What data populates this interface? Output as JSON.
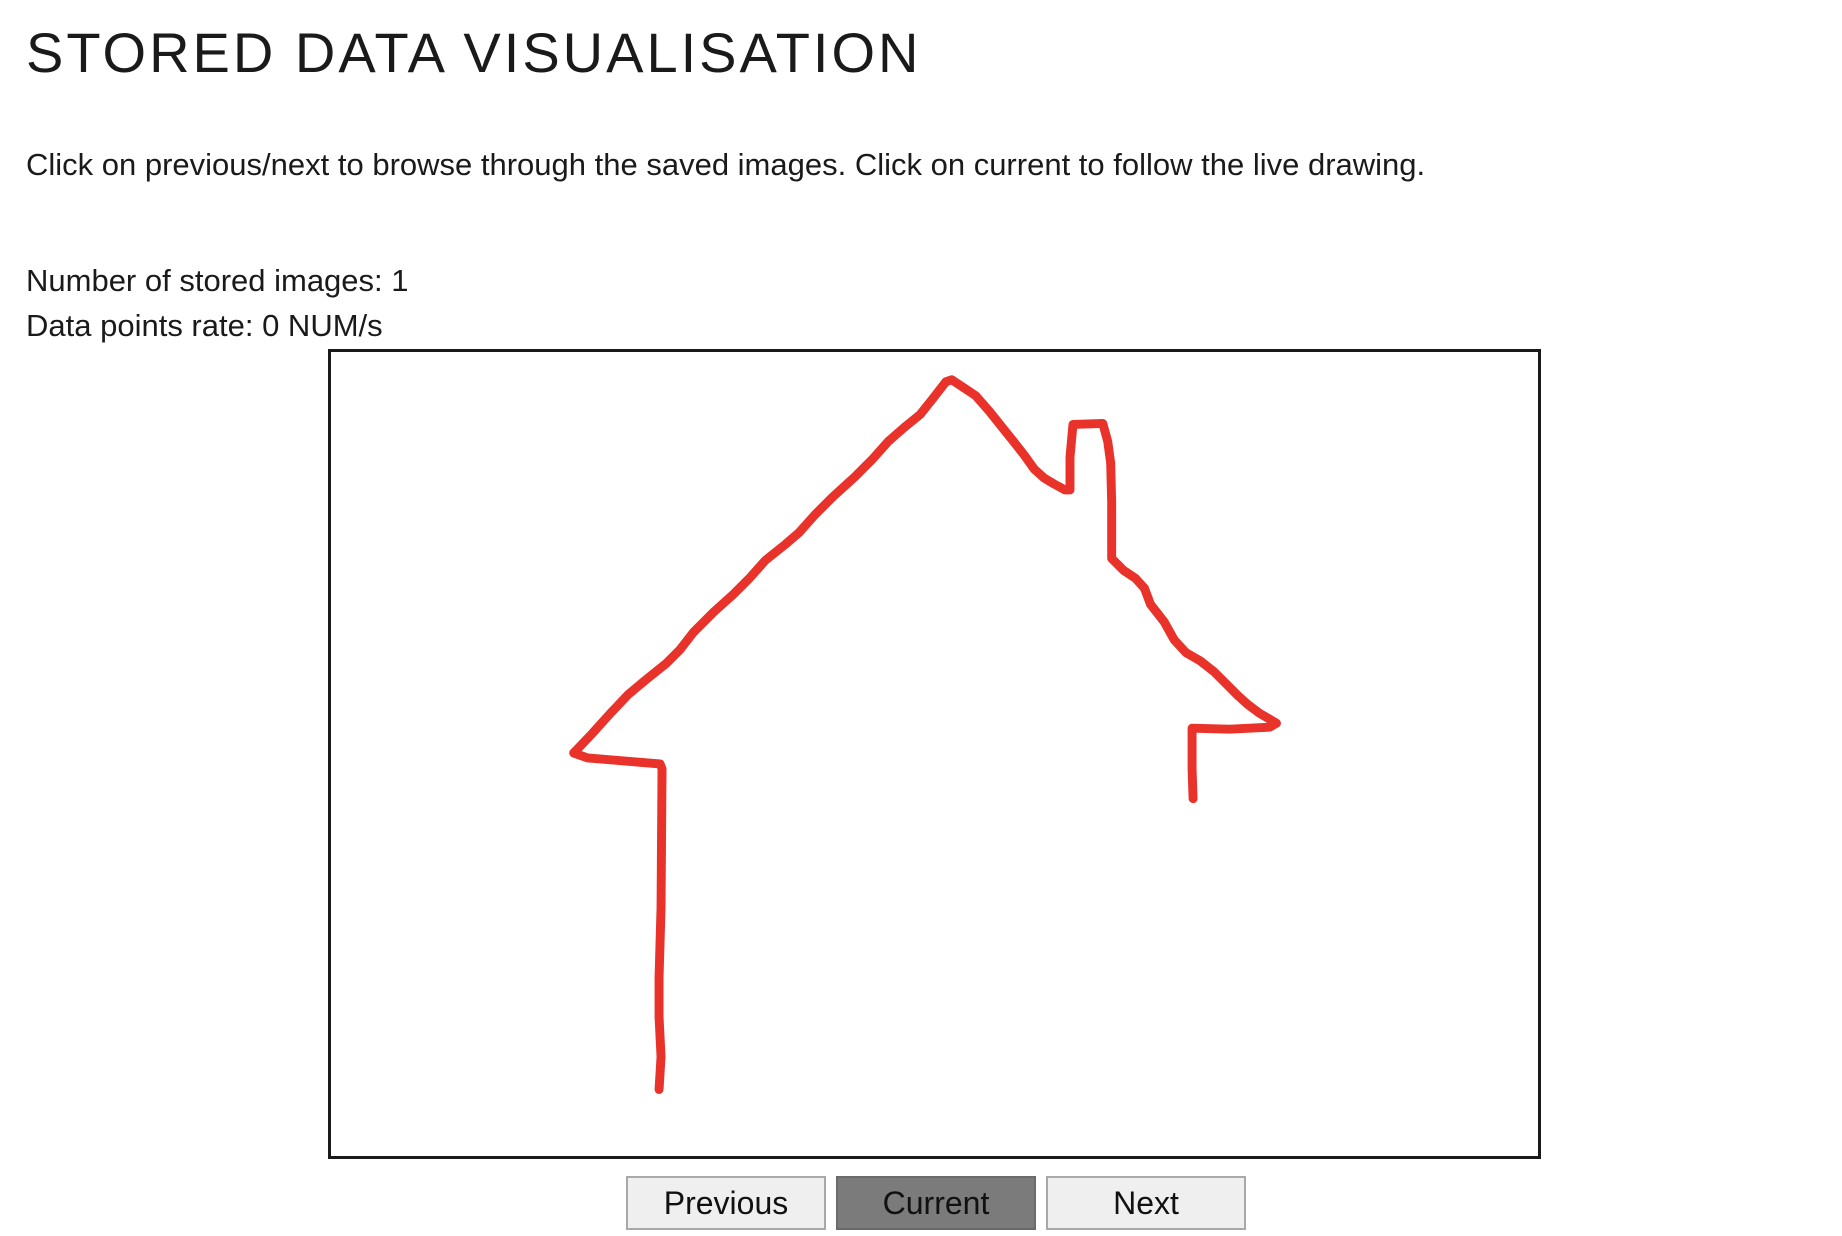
{
  "page": {
    "title": "STORED DATA VISUALISATION",
    "instructions": "Click on previous/next to browse through the saved images. Click on current to follow the live drawing."
  },
  "stats": {
    "stored_images_text": "Number of stored images: 1",
    "rate_text": "Data points rate: 0 NUM/s"
  },
  "drawing": {
    "stroke_color": "#e8322a",
    "description_icon": "house-sketch"
  },
  "buttons": {
    "previous_label": "Previous",
    "current_label": "Current",
    "next_label": "Next",
    "active": "current",
    "active_color": "#7b7b7b",
    "inactive_color": "#efefef"
  }
}
